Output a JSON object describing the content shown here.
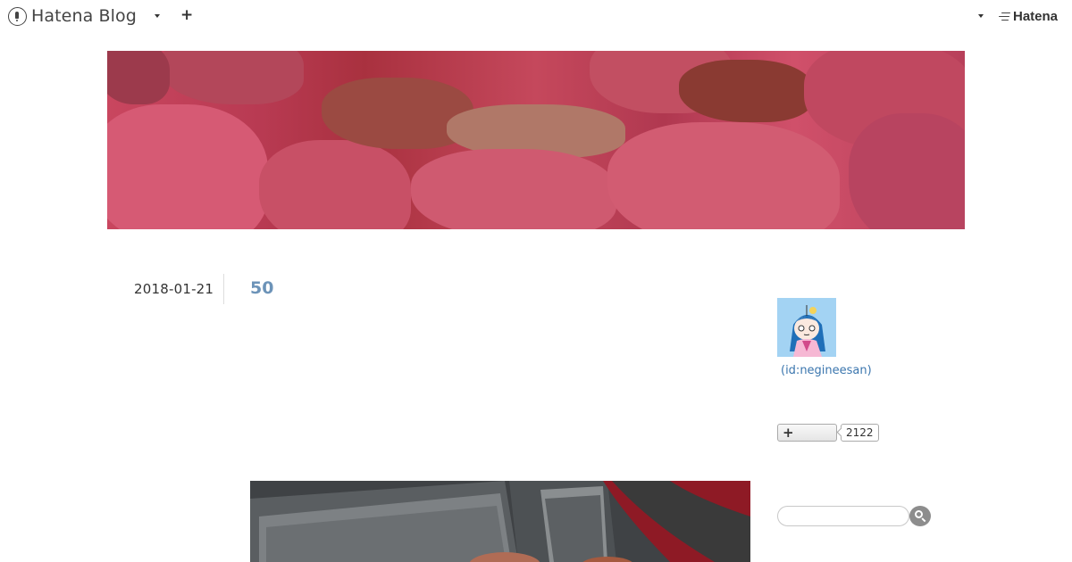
{
  "navbar": {
    "logo_text": "Hatena Blog",
    "right_brand": "Hatena",
    "icons": [
      "hatena-blog-logo-icon",
      "chevron-down-icon",
      "plus-icon",
      "chevron-down-icon",
      "hatena-logo-icon"
    ]
  },
  "entry": {
    "date": "2018-01-21",
    "title": "50"
  },
  "sidebar": {
    "profile_id": "(id:negineesan)",
    "subscriber_count": "2122",
    "search_placeholder": ""
  },
  "colors": {
    "title": "#6c93b8",
    "link": "#3b76ae",
    "banner": "#c9465f"
  }
}
